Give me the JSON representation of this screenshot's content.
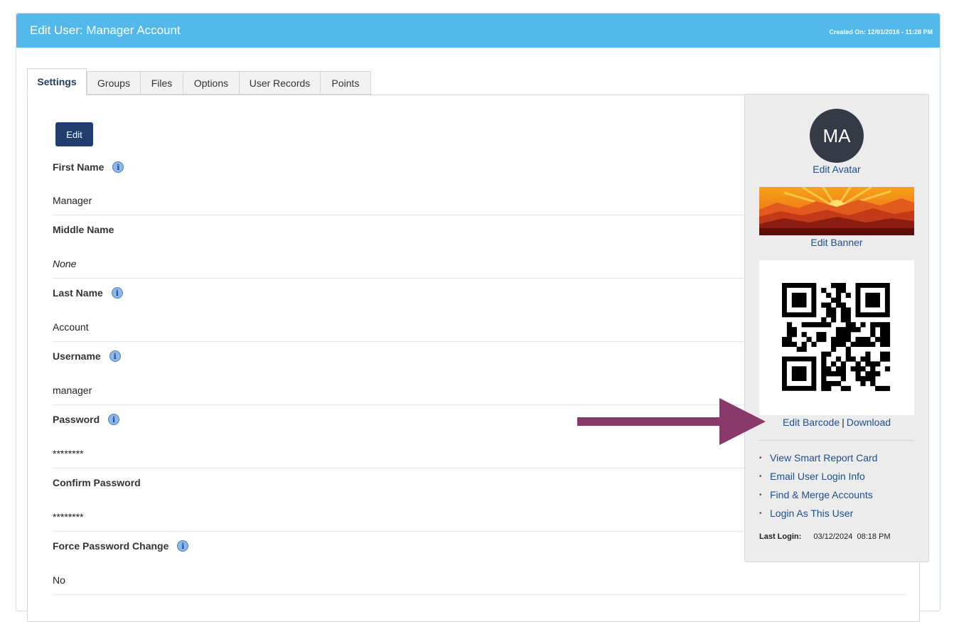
{
  "header": {
    "title": "Edit User: Manager Account",
    "created_on": "Created On: 12/01/2016 - 11:28 PM",
    "color": "#53b8ea"
  },
  "tabs": [
    {
      "label": "Settings",
      "active": true
    },
    {
      "label": "Groups",
      "active": false
    },
    {
      "label": "Files",
      "active": false
    },
    {
      "label": "Options",
      "active": false
    },
    {
      "label": "User Records",
      "active": false
    },
    {
      "label": "Points",
      "active": false
    }
  ],
  "form": {
    "edit_label": "Edit",
    "info_glyph": "i",
    "fields": [
      {
        "label": "First Name",
        "value": "Manager",
        "info": true
      },
      {
        "label": "Middle Name",
        "value": "None",
        "info": false
      },
      {
        "label": "Last Name",
        "value": "Account",
        "info": true
      },
      {
        "label": "Username",
        "value": "manager",
        "info": true
      },
      {
        "label": "Password",
        "value": "********",
        "info": true
      },
      {
        "label": "Confirm Password",
        "value": "********",
        "info": false
      },
      {
        "label": "Force Password Change",
        "value": "No",
        "info": true
      }
    ]
  },
  "sidebar": {
    "avatar_initials": "MA",
    "edit_avatar": "Edit Avatar",
    "edit_banner": "Edit Banner",
    "edit_barcode": "Edit Barcode",
    "separator": "|",
    "download": "Download",
    "actions": [
      "View Smart Report Card",
      "Email User Login Info",
      "Find & Merge Accounts",
      "Login As This User"
    ],
    "bullet": "•",
    "last_login_label": "Last Login:",
    "last_login_value": "03/12/2024  08:18 PM"
  },
  "annotation": {
    "arrow_color": "#8a3a6a"
  },
  "icons": [
    "info-icon",
    "qr-code-icon",
    "banner-image",
    "arrow-annotation-icon"
  ]
}
